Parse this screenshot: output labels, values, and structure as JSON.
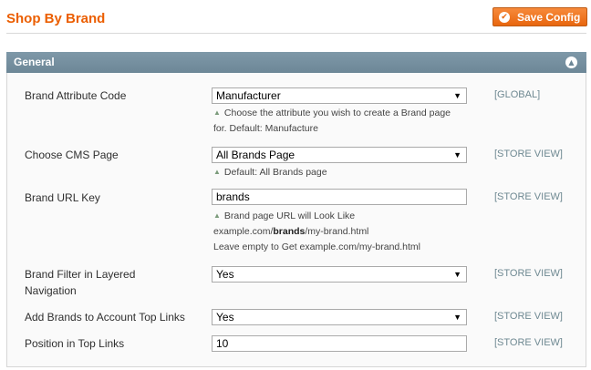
{
  "page": {
    "title": "Shop By Brand",
    "save_label": "Save Config"
  },
  "section": {
    "title": "General"
  },
  "fields": {
    "brand_attribute": {
      "label": "Brand Attribute Code",
      "value": "Manufacturer",
      "scope": "[GLOBAL]",
      "note_line1": "Choose the attribute you wish to create a Brand page",
      "note_line2": "for. Default: Manufacture"
    },
    "cms_page": {
      "label": "Choose CMS Page",
      "value": "All Brands Page",
      "scope": "[STORE VIEW]",
      "note": "Default: All Brands page"
    },
    "url_key": {
      "label": "Brand URL Key",
      "value": "brands",
      "scope": "[STORE VIEW]",
      "note_line1": "Brand page URL will Look Like",
      "note_line2_prefix": "example.com/",
      "note_line2_bold": "brands",
      "note_line2_suffix": "/my-brand.html",
      "note_line3": "Leave empty to Get example.com/my-brand.html"
    },
    "layered_nav": {
      "label_line1": "Brand Filter in Layered",
      "label_line2": "Navigation",
      "value": "Yes",
      "scope": "[STORE VIEW]"
    },
    "top_links": {
      "label": "Add Brands to Account Top Links",
      "value": "Yes",
      "scope": "[STORE VIEW]"
    },
    "position": {
      "label": "Position in Top Links",
      "value": "10",
      "scope": "[STORE VIEW]"
    }
  },
  "icons": {
    "save": "check-icon",
    "collapse": "chevron-up-icon",
    "select_arrow": "triangle-down-icon",
    "note": "triangle-up-icon"
  },
  "colors": {
    "title": "#eb5e00",
    "button": "#e8660e",
    "section_header": "#6d8797",
    "scope": "#6f8992"
  }
}
